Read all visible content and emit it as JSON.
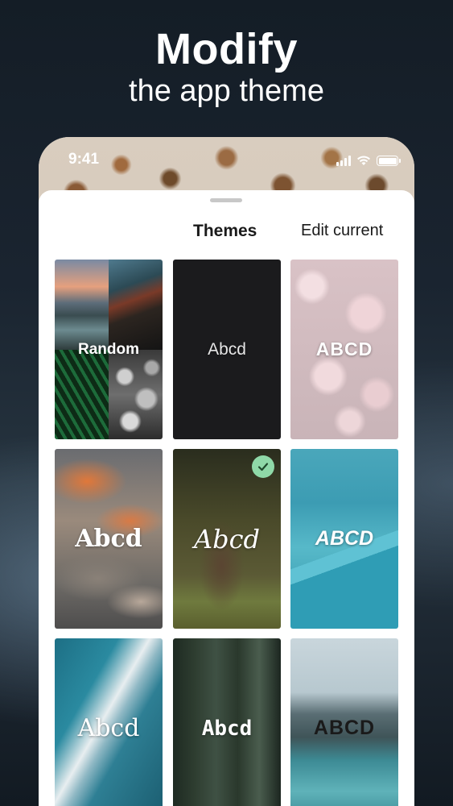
{
  "headline": {
    "title": "Modify",
    "subtitle": "the app theme"
  },
  "status_bar": {
    "time": "9:41"
  },
  "sheet": {
    "tabs": [
      {
        "label": "Themes",
        "active": true
      },
      {
        "label": "Edit current",
        "active": false
      }
    ],
    "themes": [
      {
        "label": "Random",
        "selected": false
      },
      {
        "label": "Abcd",
        "selected": false
      },
      {
        "label": "ABCD",
        "selected": false
      },
      {
        "label": "Abcd",
        "selected": false
      },
      {
        "label": "Abcd",
        "selected": true
      },
      {
        "label": "ABCD",
        "selected": false
      },
      {
        "label": "Abcd",
        "selected": false
      },
      {
        "label": "Abcd",
        "selected": false
      },
      {
        "label": "ABCD",
        "selected": false
      }
    ]
  },
  "colors": {
    "selected_badge": "#8fd9a8",
    "sheet_background": "#ffffff"
  }
}
